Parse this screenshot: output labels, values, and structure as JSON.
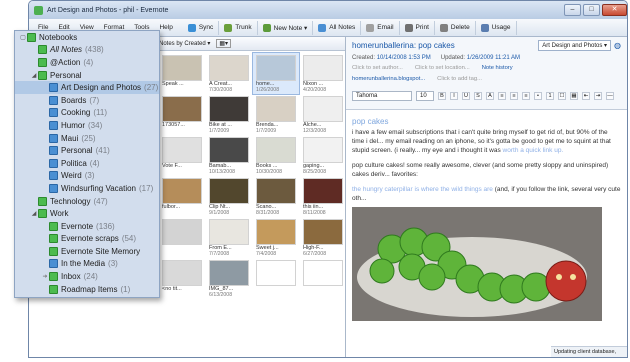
{
  "window": {
    "title": "Art Design and Photos - phil - Evernote",
    "min": "–",
    "max": "□",
    "close": "✕"
  },
  "menu": [
    "File",
    "Edit",
    "View",
    "Format",
    "Tools",
    "Help"
  ],
  "toolbar": [
    {
      "label": "Sync",
      "icon": "sync-icon",
      "color": "#3a8fd6"
    },
    {
      "label": "Trunk",
      "icon": "trunk-icon",
      "color": "#6a9f3b"
    },
    {
      "label": "New Note ▾",
      "icon": "new-note-icon",
      "color": "#5c9b3a"
    },
    {
      "label": "All Notes",
      "icon": "all-notes-icon",
      "color": "#4a8fd3"
    },
    {
      "label": "Email",
      "icon": "email-icon",
      "color": "#a0a0a0"
    },
    {
      "label": "Print",
      "icon": "print-icon",
      "color": "#707070"
    },
    {
      "label": "Delete",
      "icon": "delete-icon",
      "color": "#808080"
    },
    {
      "label": "Usage",
      "icon": "usage-icon",
      "color": "#5a7db0"
    }
  ],
  "listbar": {
    "sort": "Notes by Created ▾"
  },
  "sidebar": [
    {
      "label": "Notebooks",
      "count": "",
      "indent": 0,
      "toggle": "▢",
      "icon": "g"
    },
    {
      "label": "All Notes",
      "count": "(438)",
      "indent": 1,
      "icon": "g",
      "italic": true
    },
    {
      "label": "@Action",
      "count": "(4)",
      "indent": 1,
      "icon": "g"
    },
    {
      "label": "Personal",
      "count": "",
      "indent": 1,
      "toggle": "◢",
      "icon": "g"
    },
    {
      "label": "Art Design and Photos",
      "count": "(27)",
      "indent": 2,
      "icon": "b",
      "selected": true
    },
    {
      "label": "Boards",
      "count": "(7)",
      "indent": 2,
      "icon": "b"
    },
    {
      "label": "Cooking",
      "count": "(11)",
      "indent": 2,
      "icon": "b"
    },
    {
      "label": "Humor",
      "count": "(34)",
      "indent": 2,
      "icon": "b"
    },
    {
      "label": "Maui",
      "count": "(25)",
      "indent": 2,
      "icon": "b"
    },
    {
      "label": "Personal",
      "count": "(41)",
      "indent": 2,
      "icon": "b"
    },
    {
      "label": "Politica",
      "count": "(4)",
      "indent": 2,
      "icon": "b"
    },
    {
      "label": "Weird",
      "count": "(3)",
      "indent": 2,
      "icon": "b"
    },
    {
      "label": "Windsurfing Vacation",
      "count": "(17)",
      "indent": 2,
      "icon": "b"
    },
    {
      "label": "Technology",
      "count": "(47)",
      "indent": 1,
      "icon": "g"
    },
    {
      "label": "Work",
      "count": "",
      "indent": 1,
      "toggle": "◢",
      "icon": "g"
    },
    {
      "label": "Evernote",
      "count": "(136)",
      "indent": 2,
      "icon": "g"
    },
    {
      "label": "Evernote scraps",
      "count": "(54)",
      "indent": 2,
      "icon": "g"
    },
    {
      "label": "Evernote Site Memory",
      "count": "",
      "indent": 2,
      "icon": "g"
    },
    {
      "label": "In the Media",
      "count": "(3)",
      "indent": 2,
      "icon": "b"
    },
    {
      "label": "Inbox",
      "count": "(24)",
      "indent": 2,
      "icon": "g",
      "arrow": true
    },
    {
      "label": "Roadmap Items",
      "count": "(1)",
      "indent": 2,
      "icon": "g"
    }
  ],
  "grid": [
    {
      "cap": "Speak ...",
      "date": "",
      "c": "#c9c2b2"
    },
    {
      "cap": "A Creat...",
      "date": "7/30/2008",
      "c": "#dcd6cc"
    },
    {
      "cap": "home...",
      "date": "1/26/2008",
      "c": "#b7c8d9",
      "sel": true
    },
    {
      "cap": "Nixon ...",
      "date": "4/20/2008",
      "c": "#ececec"
    },
    {
      "cap": "173057...",
      "date": "",
      "c": "#8a6d4b"
    },
    {
      "cap": "Bike at ...",
      "date": "1/7/2009",
      "c": "#3f3a37"
    },
    {
      "cap": "Brenda...",
      "date": "1/7/2009",
      "c": "#d8d0c4"
    },
    {
      "cap": "Alche...",
      "date": "12/3/2008",
      "c": "#efefef"
    },
    {
      "cap": "Vote F...",
      "date": "",
      "c": "#e0e0e0"
    },
    {
      "cap": "Bamab...",
      "date": "10/13/2008",
      "c": "#494949"
    },
    {
      "cap": "Books ...",
      "date": "10/30/2008",
      "c": "#d9dbd2"
    },
    {
      "cap": "gaping...",
      "date": "8/25/2008",
      "c": "#f2f2f2"
    },
    {
      "cap": "fulbor...",
      "date": "",
      "c": "#b58d5a"
    },
    {
      "cap": "Clip Nt...",
      "date": "9/1/2008",
      "c": "#52472d"
    },
    {
      "cap": "Scano...",
      "date": "8/31/2008",
      "c": "#6c5a3e"
    },
    {
      "cap": "this iin...",
      "date": "8/11/2008",
      "c": "#5f2b24"
    },
    {
      "cap": "",
      "date": "",
      "c": "#d3d3d3"
    },
    {
      "cap": "From E...",
      "date": "7/7/2008",
      "c": "#e8e6e0"
    },
    {
      "cap": "Sweet j...",
      "date": "7/4/2008",
      "c": "#c49a5c"
    },
    {
      "cap": "High-F...",
      "date": "6/27/2008",
      "c": "#8b6a3e"
    },
    {
      "cap": "<no tit...",
      "date": "",
      "c": "#d9d9d9"
    },
    {
      "cap": "IMG_87...",
      "date": "6/13/2008",
      "c": "#8e9aa3"
    },
    {
      "cap": "",
      "date": "",
      "c": "#fff"
    },
    {
      "cap": "",
      "date": "",
      "c": "#fff"
    }
  ],
  "note": {
    "title": "homerunballerina: pop cakes",
    "notebook": "Art Design and Photos ▾",
    "created_label": "Created:",
    "created": "10/14/2008 1:53 PM",
    "updated_label": "Updated:",
    "updated": "1/26/2009 11:21 AM",
    "author_placeholder": "Click to set author...",
    "location_placeholder": "Click to set location...",
    "history": "Note history",
    "source": "homerunballerina.blogspot...",
    "tags_placeholder": "Click to add tag...",
    "font": "Tahoma",
    "size": "10",
    "heading": "pop cakes",
    "p1": "i have a few email subscriptions that i can't quite bring myself to get rid of, but 90% of the time i del... my email reading on an iphone, so it's gotta be good to get me to squint at that stupid screen. (i really... my eye and i thought it was",
    "p1_link": "worth a quick link up.",
    "p2": "pop culture cakes! some really awesome, clever (and some pretty sloppy and uninspired) cakes deriv... favorites:",
    "p3_link": "the hungry caterpillar is where the wild things are",
    "p3": "(and, if you follow the link, several very cute oth..."
  },
  "status": "Updating client database, 33% done"
}
